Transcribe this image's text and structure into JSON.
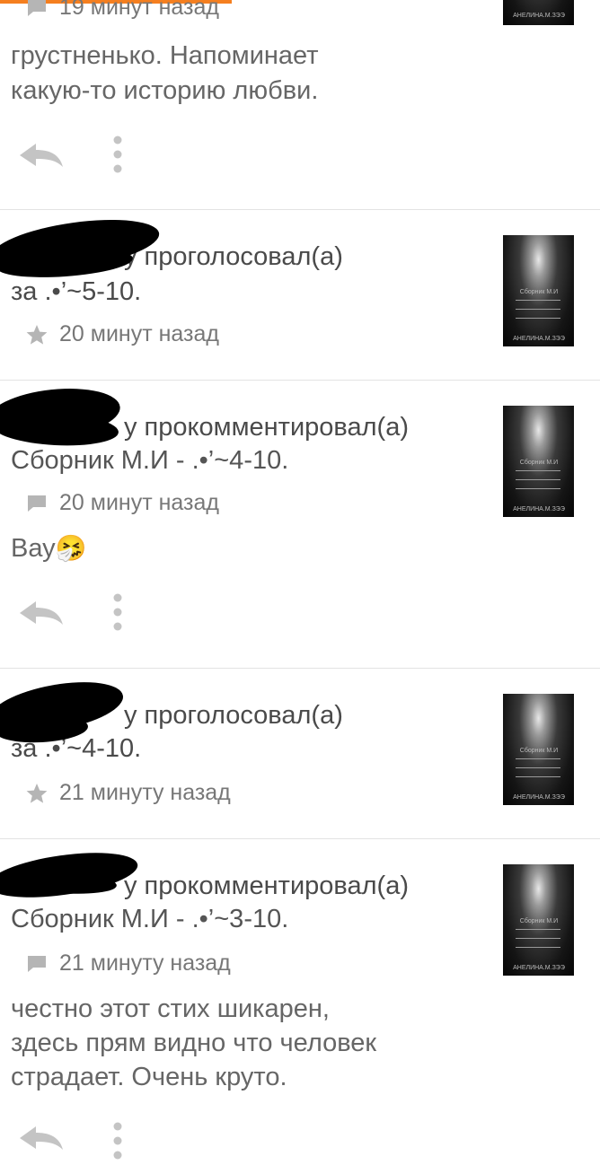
{
  "colors": {
    "accent": "#f57f1f"
  },
  "thumbnail": {
    "title": "Сборник М.И",
    "author": "АНЕЛИНА.М.ЗЭЭ"
  },
  "card0": {
    "time": "19 минут назад",
    "comment_lines": [
      "грустненько. Напоминает",
      "какую-то историю любви."
    ]
  },
  "card1": {
    "action": "у проголосовал(а)",
    "target": "за .•’~5-10.",
    "time": "20 минут назад"
  },
  "card2": {
    "action": "у прокомментировал(а)",
    "target": "Сборник М.И - .•’~4-10.",
    "time": "20 минут назад",
    "comment": "Вау",
    "emoji": "🤧"
  },
  "card3": {
    "action": "у проголосовал(а)",
    "target": "за .•’~4-10.",
    "time": "21 минуту назад"
  },
  "card4": {
    "action": "у прокомментировал(а)",
    "target": "Сборник М.И - .•’~3-10.",
    "time": "21 минуту назад",
    "comment_lines": [
      "честно этот стих шикарен,",
      "здесь прям видно что человек",
      "страдает. Очень круто."
    ]
  }
}
